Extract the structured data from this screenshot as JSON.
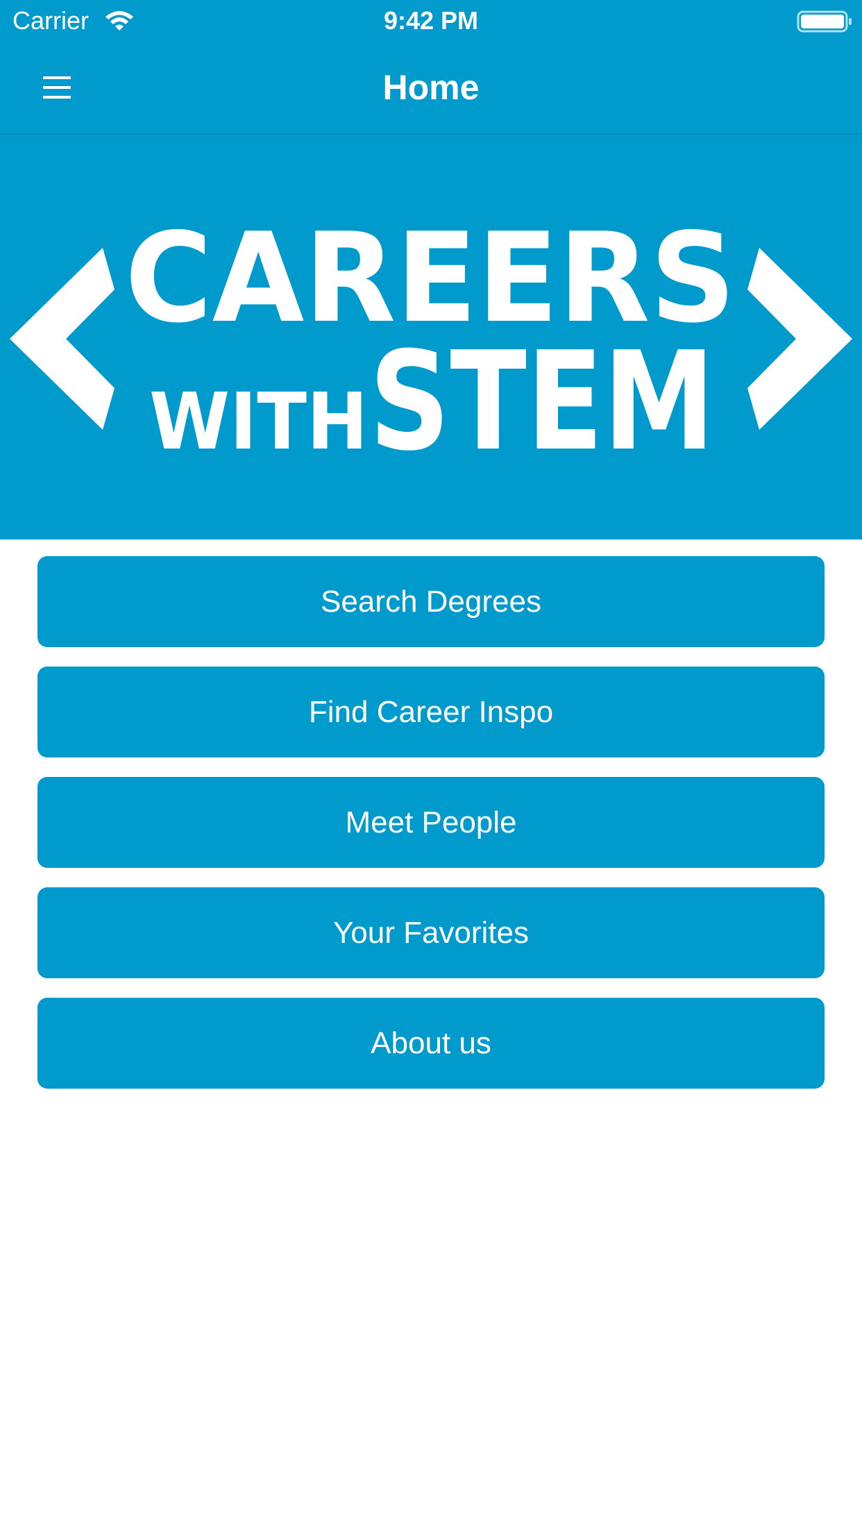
{
  "status_bar": {
    "carrier": "Carrier",
    "time": "9:42 PM",
    "wifi_icon": "wifi-icon",
    "battery_icon": "battery-icon"
  },
  "nav": {
    "title": "Home",
    "menu_icon": "hamburger-menu-icon"
  },
  "banner": {
    "logo_line1": "CAREERS",
    "logo_with": "WITH",
    "logo_stem": "STEM"
  },
  "buttons": [
    {
      "label": "Search Degrees"
    },
    {
      "label": "Find Career Inspo"
    },
    {
      "label": "Meet People"
    },
    {
      "label": "Your Favorites"
    },
    {
      "label": "About us"
    }
  ],
  "colors": {
    "brand_blue": "#009acc",
    "white": "#ffffff"
  }
}
